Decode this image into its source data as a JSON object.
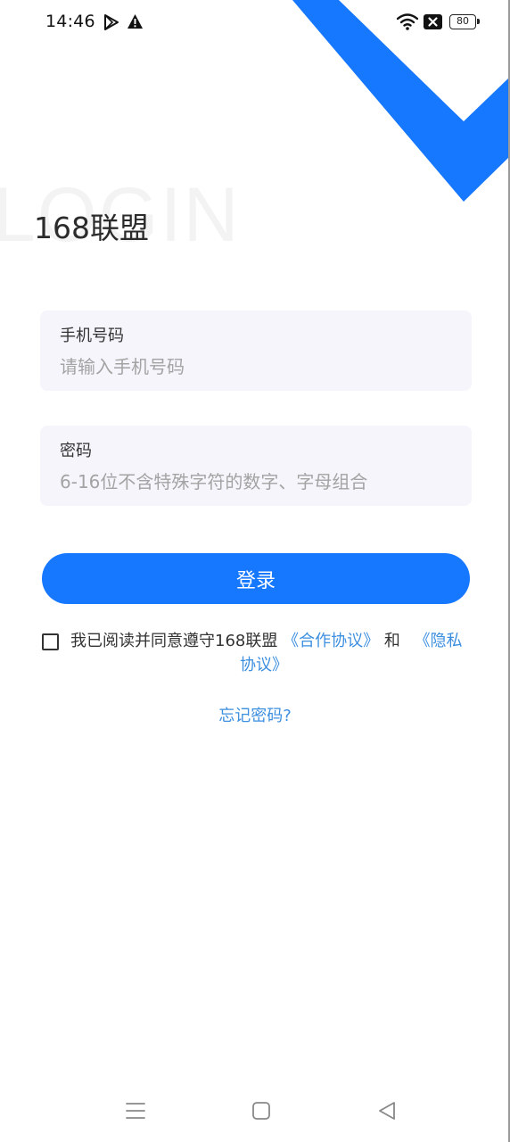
{
  "status_bar": {
    "time": "14:46",
    "battery_level": "80",
    "icons": [
      "play-store-icon",
      "warning-icon",
      "wifi-icon",
      "sim-disabled-icon",
      "battery-icon"
    ]
  },
  "header": {
    "background_word": "LOGIN",
    "title": "168联盟"
  },
  "form": {
    "phone": {
      "label": "手机号码",
      "placeholder": "请输入手机号码",
      "value": ""
    },
    "password": {
      "label": "密码",
      "placeholder": "6-16位不含特殊字符的数字、字母组合",
      "value": ""
    },
    "login_label": "登录"
  },
  "agreement": {
    "checked": false,
    "prefix": "我已阅读并同意遵守168联盟",
    "cooperation_link": "《合作协议》",
    "conjunction": "和",
    "privacy_link_part1": "《隐私",
    "privacy_link_part2": "协议》"
  },
  "forgot_password": "忘记密码?",
  "nav_bar": {
    "icons": [
      "menu-icon",
      "home-icon",
      "back-icon"
    ]
  },
  "colors": {
    "accent": "#1677ff",
    "link": "#3d8fe0",
    "field_bg": "#f7f5fc"
  }
}
